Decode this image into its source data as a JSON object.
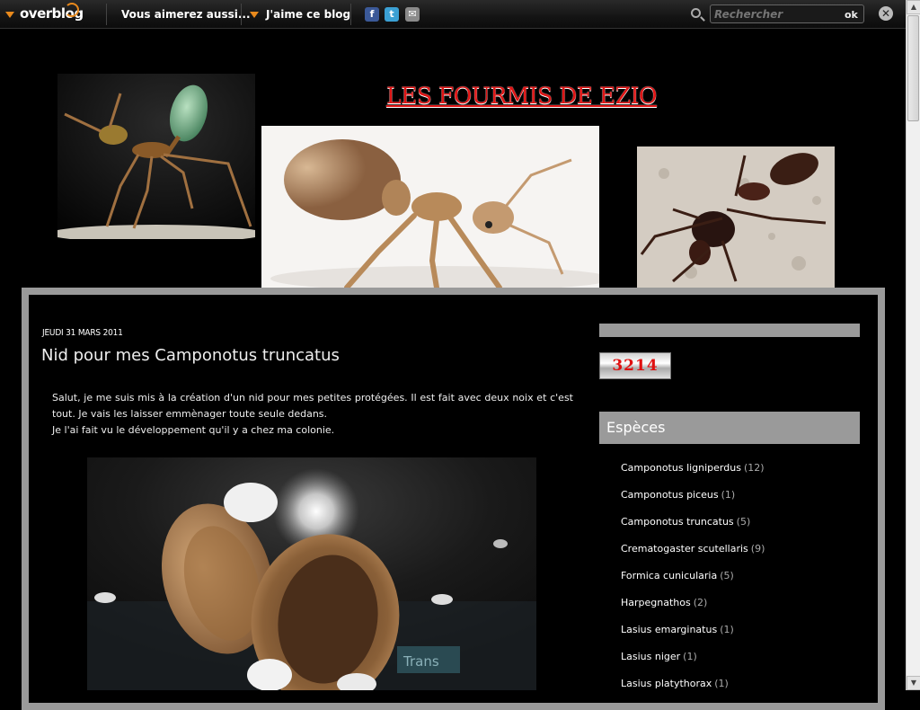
{
  "topbar": {
    "logo": "overblog",
    "links": [
      "Vous aimerez aussi...",
      "J'aime ce blog"
    ],
    "social": [
      {
        "icon": "facebook-icon",
        "glyph": "f",
        "color": "#3b5998"
      },
      {
        "icon": "twitter-icon",
        "glyph": "t",
        "color": "#3ba0d4"
      },
      {
        "icon": "email-icon",
        "glyph": "✉",
        "color": "#8a8a8a"
      }
    ],
    "search_placeholder": "Rechercher",
    "search_button": "ok",
    "close_glyph": "✕",
    "accent_color": "#e8891c"
  },
  "header": {
    "title": "LES FOURMIS DE EZIO"
  },
  "post": {
    "date": "JEUDI 31 MARS 2011",
    "title": "Nid pour mes Camponotus truncatus",
    "paragraph1": "Salut, je me suis mis à la création d'un nid pour mes petites protégées. Il est fait avec deux noix et c'est tout. Je vais les laisser emmènager toute seule dedans.",
    "paragraph2": "Je l'ai fait vu le développement qu'il y a chez ma colonie.",
    "image_caption_text": "Trans"
  },
  "sidebar": {
    "counter": "3214",
    "heading": "Espèces",
    "categories": [
      {
        "name": "Camponotus ligniperdus",
        "count": "(12)"
      },
      {
        "name": "Camponotus piceus",
        "count": "(1)"
      },
      {
        "name": "Camponotus truncatus",
        "count": "(5)"
      },
      {
        "name": "Crematogaster scutellaris",
        "count": "(9)"
      },
      {
        "name": "Formica cunicularia",
        "count": "(5)"
      },
      {
        "name": "Harpegnathos",
        "count": "(2)"
      },
      {
        "name": "Lasius emarginatus",
        "count": "(1)"
      },
      {
        "name": "Lasius niger",
        "count": "(1)"
      },
      {
        "name": "Lasius platythorax",
        "count": "(1)"
      }
    ]
  },
  "scrollbar": {
    "up_arrow": "▲",
    "down_arrow": "▼"
  }
}
